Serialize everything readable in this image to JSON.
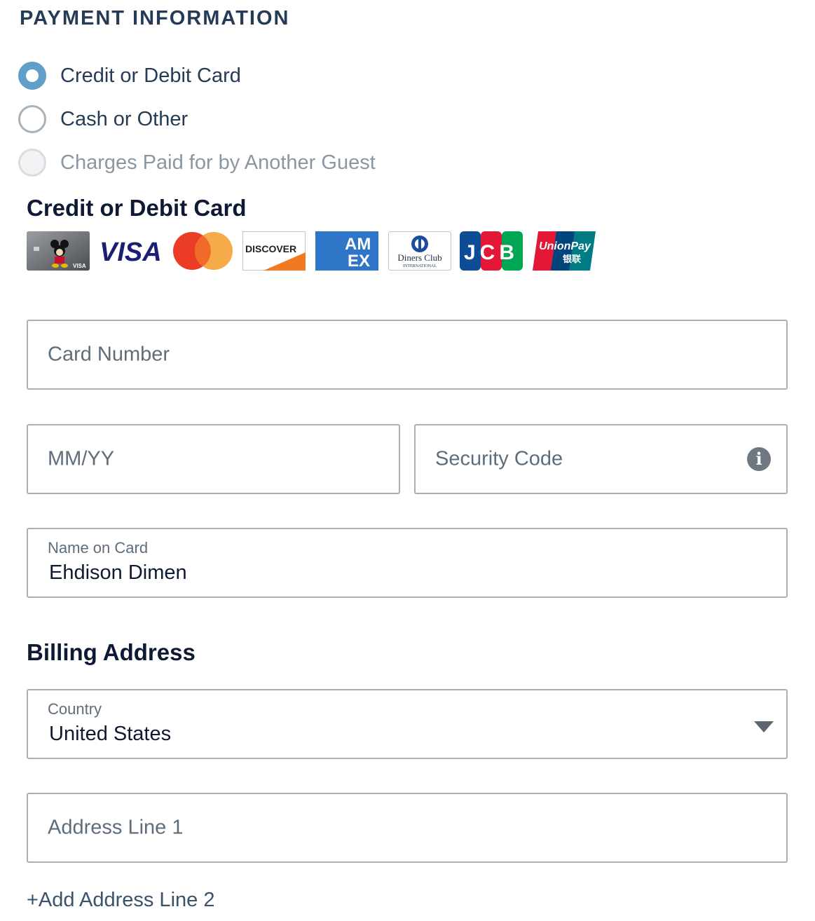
{
  "page": {
    "heading": "PAYMENT INFORMATION"
  },
  "payment_options": [
    {
      "label": "Credit or Debit Card",
      "state": "checked"
    },
    {
      "label": "Cash or Other",
      "state": "unchecked"
    },
    {
      "label": "Charges Paid for by Another Guest",
      "state": "disabled"
    }
  ],
  "card_section": {
    "title": "Credit or Debit Card",
    "logos": [
      "disney-visa-card",
      "visa",
      "mastercard",
      "discover",
      "american-express",
      "diners-club",
      "jcb",
      "unionpay"
    ],
    "logo_text": {
      "visa": "VISA",
      "discover": "DISCOVER",
      "amex_top": "AM",
      "amex_bottom": "EX",
      "diners": "Diners Club",
      "diners_sub": "INTERNATIONAL",
      "jcb": "JCB",
      "unionpay": "UnionPay",
      "unionpay_cn": "银联",
      "disney_visa": "VISA"
    },
    "card_number": {
      "placeholder": "Card Number",
      "value": ""
    },
    "expiry": {
      "placeholder": "MM/YY",
      "value": ""
    },
    "security_code": {
      "placeholder": "Security Code",
      "value": "",
      "icon": "info-icon"
    },
    "name_on_card": {
      "label": "Name on Card",
      "value": "Ehdison Dimen"
    }
  },
  "billing": {
    "title": "Billing Address",
    "country": {
      "label": "Country",
      "value": "United States",
      "icon": "chevron-down-icon"
    },
    "address_line_1": {
      "placeholder": "Address Line 1",
      "value": ""
    },
    "add_line_2": "+Add Address Line 2"
  },
  "colors": {
    "accent": "#5f9fc8",
    "text_dark": "#0e1a33",
    "heading": "#253b56",
    "border": "#a7b0b8"
  }
}
